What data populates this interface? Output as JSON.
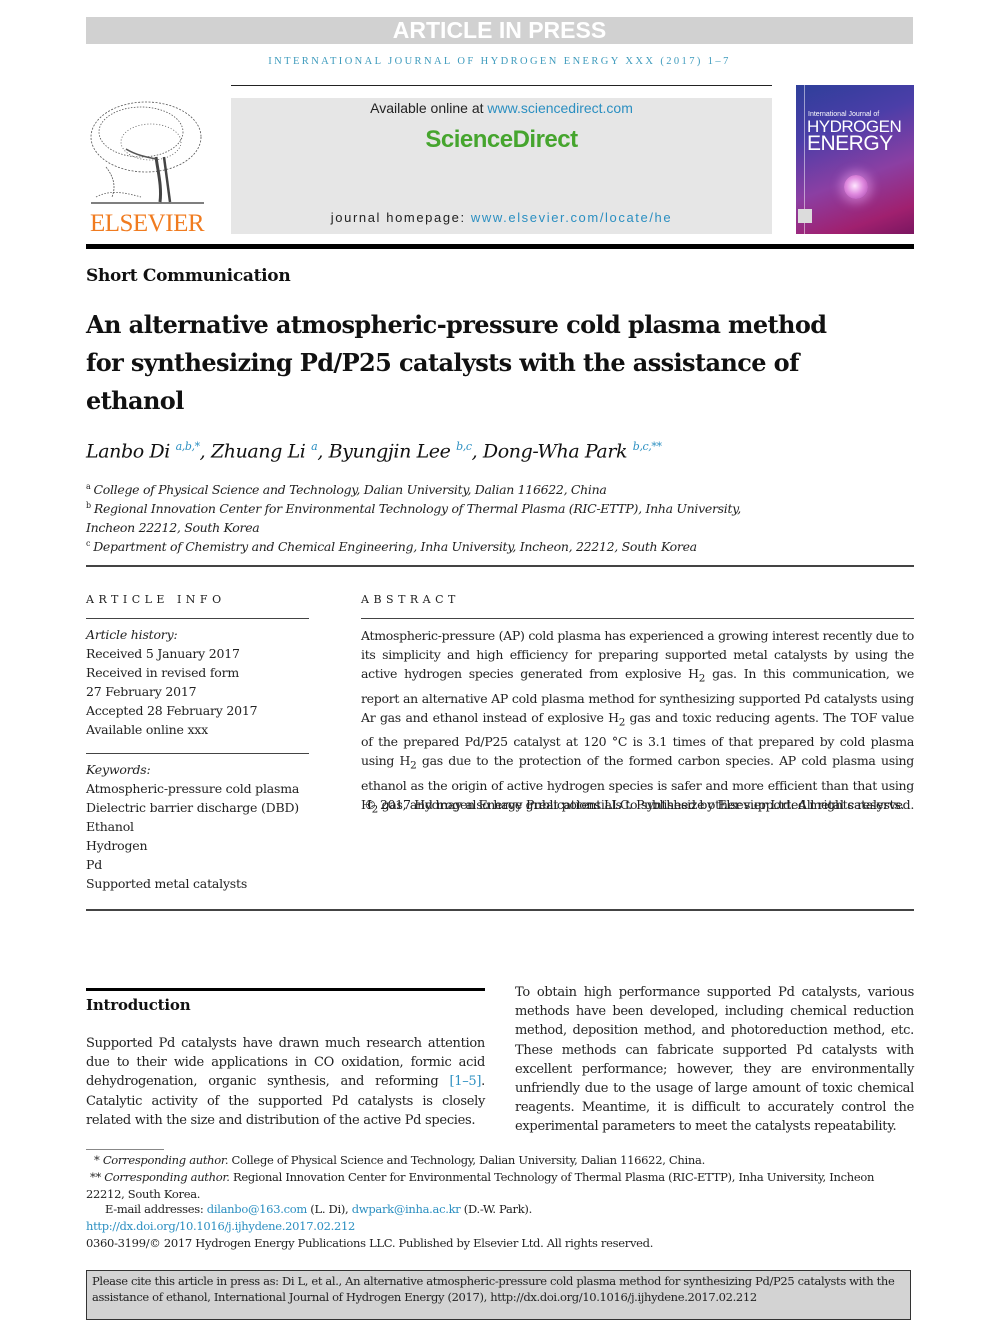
{
  "banner": "ARTICLE IN PRESS",
  "journal_line": "INTERNATIONAL JOURNAL OF HYDROGEN ENERGY XXX (2017) 1–7",
  "masthead": {
    "publisher": "ELSEVIER",
    "available_prefix": "Available online at ",
    "available_link": "www.sciencedirect.com",
    "brand": "ScienceDirect",
    "homepage_prefix": "journal homepage: ",
    "homepage_link": "www.elsevier.com/locate/he",
    "cover": {
      "line1": "International Journal of",
      "line2": "HYDROGEN",
      "line3": "ENERGY"
    }
  },
  "article": {
    "type": "Short Communication",
    "title": "An alternative atmospheric-pressure cold plasma method for synthesizing Pd/P25 catalysts with the assistance of ethanol",
    "authors": [
      {
        "name": "Lanbo Di",
        "sup": "a,b,*"
      },
      {
        "name": "Zhuang Li",
        "sup": "a"
      },
      {
        "name": "Byungjin Lee",
        "sup": "b,c"
      },
      {
        "name": "Dong-Wha Park",
        "sup": "b,c,**"
      }
    ],
    "affiliations": [
      {
        "label": "a",
        "text": "College of Physical Science and Technology, Dalian University, Dalian 116622, China"
      },
      {
        "label": "b",
        "text": "Regional Innovation Center for Environmental Technology of Thermal Plasma (RIC-ETTP), Inha University, Incheon 22212, South Korea"
      },
      {
        "label": "c",
        "text": "Department of Chemistry and Chemical Engineering, Inha University, Incheon, 22212, South Korea"
      }
    ]
  },
  "article_info": {
    "heading": "ARTICLE INFO",
    "history_label": "Article history:",
    "history": [
      "Received 5 January 2017",
      "Received in revised form",
      "27 February 2017",
      "Accepted 28 February 2017",
      "Available online xxx"
    ],
    "keywords_label": "Keywords:",
    "keywords": [
      "Atmospheric-pressure cold plasma",
      "Dielectric barrier discharge (DBD)",
      "Ethanol",
      "Hydrogen",
      "Pd",
      "Supported metal catalysts"
    ]
  },
  "abstract": {
    "heading": "ABSTRACT",
    "parts": [
      "Atmospheric-pressure (AP) cold plasma has experienced a growing interest recently due to its simplicity and high efficiency for preparing supported metal catalysts by using the active hydrogen species generated from explosive H",
      "2",
      " gas. In this communication, we report an alternative AP cold plasma method for synthesizing supported Pd catalysts using Ar gas and ethanol instead of explosive H",
      "2",
      " gas and toxic reducing agents. The TOF value of the prepared Pd/P25 catalyst at 120 °C is 3.1 times of that prepared by cold plasma using H",
      "2",
      " gas due to the protection of the formed carbon species. AP cold plasma using ethanol as the origin of active hydrogen species is safer and more efficient than that using H",
      "2",
      " gas, and may also have great potentials to synthesize other supported metal catalysts."
    ],
    "copyright": "© 2017 Hydrogen Energy Publications LLC. Published by Elsevier Ltd. All rights reserved."
  },
  "body": {
    "intro_heading": "Introduction",
    "intro_p1_a": "Supported Pd catalysts have drawn much research attention due to their wide applications in CO oxidation, formic acid dehydrogenation, organic synthesis, and reforming ",
    "intro_p1_ref": "[1–5]",
    "intro_p1_b": ". Catalytic activity of the supported Pd catalysts is closely related with the size and distribution of the active Pd species.",
    "col2_p1": "To obtain high performance supported Pd catalysts, various methods have been developed, including chemical reduction method, deposition method, and photoreduction method, etc. These methods can fabricate supported Pd catalysts with excellent performance; however, they are environmentally unfriendly due to the usage of large amount of toxic chemical reagents. Meantime, it is difficult to accurately control the experimental parameters to meet the catalysts repeatability."
  },
  "footnotes": {
    "fn1_mark": "*",
    "fn1_label": "Corresponding author.",
    "fn1_text": " College of Physical Science and Technology, Dalian University, Dalian 116622, China.",
    "fn2_mark": "**",
    "fn2_label": "Corresponding author.",
    "fn2_text": " Regional Innovation Center for Environmental Technology of Thermal Plasma (RIC-ETTP), Inha University, Incheon 22212, South Korea.",
    "email_label": "E-mail addresses: ",
    "email1": "dilanbo@163.com",
    "email1_who": " (L. Di), ",
    "email2": "dwpark@inha.ac.kr",
    "email2_who": " (D.-W. Park).",
    "doi": "http://dx.doi.org/10.1016/j.ijhydene.2017.02.212",
    "issn_line": "0360-3199/© 2017 Hydrogen Energy Publications LLC. Published by Elsevier Ltd. All rights reserved."
  },
  "citation_box": "Please cite this article in press as: Di L, et al., An alternative atmospheric-pressure cold plasma method for synthesizing Pd/P25 catalysts with the assistance of ethanol, International Journal of Hydrogen Energy (2017), http://dx.doi.org/10.1016/j.ijhydene.2017.02.212",
  "colors": {
    "link": "#2b8fc1",
    "sciencedirect_green": "#46a52e",
    "elsevier_orange": "#f07b1f",
    "banner_gray": "#d1d1d1"
  }
}
